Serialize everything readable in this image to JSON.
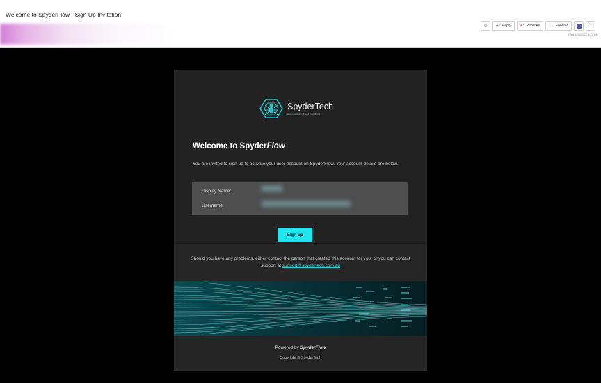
{
  "email": {
    "subject": "Welcome to SpyderFlow - Sign Up Invitation",
    "date": "Wed 6/08/2022 5:10 PM"
  },
  "toolbar": {
    "reply_label": "Reply",
    "reply_all_label": "Reply All",
    "forward_label": "Forward",
    "more_label": "···"
  },
  "logo": {
    "brand": "SpyderTech",
    "tagline": "Innovation That Matters"
  },
  "content": {
    "welcome_prefix": "Welcome to Spyder",
    "welcome_flow": "Flow",
    "intro": "You are invited to sign up to activate your user account on SpyderFlow. Your account details are below.",
    "display_name_label": "Display Name:",
    "username_label": "Username:",
    "signup_label": "Sign up",
    "problems_text": "Should you have any problems, either contact the person that created this account for you, or you can contact support at ",
    "support_email": "support@spydertech.com.au"
  },
  "footer": {
    "powered_prefix": "Powered by ",
    "powered_brand": "SpyderFlow",
    "copyright": "Copyright © SpyderTech"
  },
  "colors": {
    "accent": "#21e5ee",
    "card_bg": "#222222",
    "details_bg": "#4e4e4e"
  }
}
